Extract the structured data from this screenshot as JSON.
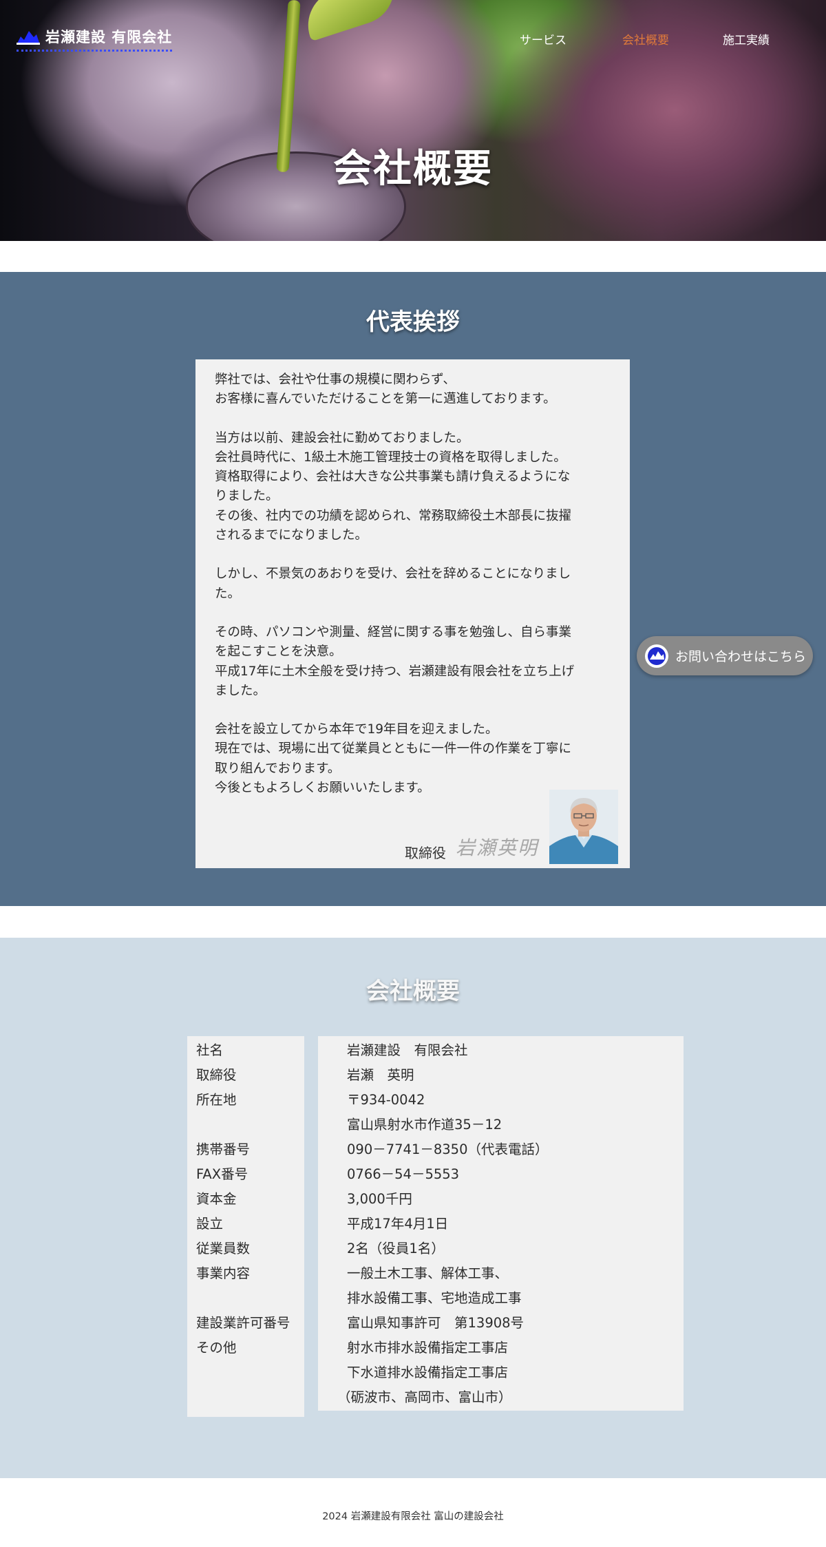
{
  "header": {
    "logo_text": "岩瀬建設 有限会社",
    "nav": [
      {
        "label": "サービス",
        "active": false
      },
      {
        "label": "会社概要",
        "active": true
      },
      {
        "label": "施工実績",
        "active": false
      }
    ],
    "hero_title": "会社概要"
  },
  "greeting": {
    "title": "代表挨拶",
    "paragraphs": [
      "弊社では、会社や仕事の規模に関わらず、\nお客様に喜んでいただけることを第一に邁進しております。",
      "当方は以前、建設会社に勤めておりました。\n会社員時代に、1級土木施工管理技士の資格を取得しました。\n資格取得により、会社は大きな公共事業も請け負えるようにな\nりました。\nその後、社内での功績を認められ、常務取締役土木部長に抜擢\nされるまでになりました。",
      "しかし、不景気のあおりを受け、会社を辞めることになりまし\nた。",
      "その時、パソコンや測量、経営に関する事を勉強し、自ら事業\nを起こすことを決意。\n平成17年に土木全般を受け持つ、岩瀬建設有限会社を立ち上げ\nました。",
      "会社を設立してから本年で19年目を迎えました。\n現在では、現場に出て従業員とともに一件一件の作業を丁寧に\n取り組んでおります。\n今後ともよろしくお願いいたします。"
    ],
    "signature_role": "取締役",
    "signature_name": "岩瀬英明"
  },
  "contact_button": {
    "label": "お問い合わせはこちら"
  },
  "overview": {
    "title": "会社概要",
    "labels": [
      "社名",
      "取締役",
      "所在地",
      "携帯番号",
      "FAX番号",
      "資本金",
      "設立",
      "従業員数",
      "事業内容",
      "建設業許可番号",
      "その他"
    ],
    "values": [
      "岩瀬建設　有限会社",
      "岩瀬　英明",
      "〒934-0042",
      "富山県射水市作道35－12",
      "090－7741－8350（代表電話）",
      "0766－54－5553",
      "3,000千円",
      "平成17年4月1日",
      "2名（役員1名）",
      "一般土木工事、解体工事、",
      "排水設備工事、宅地造成工事",
      "富山県知事許可　第13908号",
      "射水市排水設備指定工事店",
      "下水道排水設備指定工事店",
      "（砺波市、高岡市、富山市）"
    ]
  },
  "footer": {
    "text": "2024 岩瀬建設有限会社 富山の建設会社"
  }
}
